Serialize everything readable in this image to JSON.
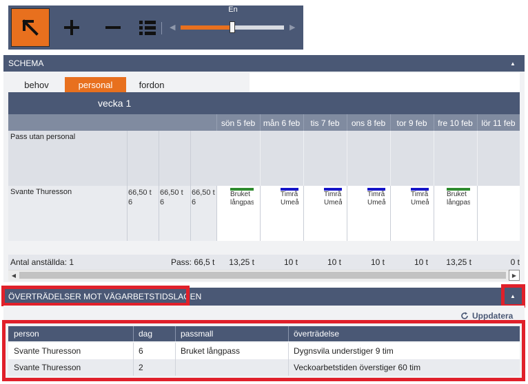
{
  "toolbar": {
    "zoom_label": "En",
    "zoom_level": 0.5,
    "icons": [
      "select-arrow-icon",
      "plus-icon",
      "minus-icon",
      "list-icon"
    ]
  },
  "schema": {
    "title": "SCHEMA",
    "tabs": [
      "behov",
      "personal",
      "fordon"
    ],
    "active_tab": "personal",
    "week": "vecka 1",
    "days": [
      "sön 5 feb",
      "mån 6 feb",
      "tis 7 feb",
      "ons 8 feb",
      "tor 9 feb",
      "fre 10 feb",
      "lör 11 feb"
    ],
    "rows": [
      {
        "name": "Pass utan personal"
      },
      {
        "name": "Svante Thuresson",
        "values": [
          "66,50 t 6",
          "66,50 t 6",
          "66,50 t 6"
        ],
        "shifts": [
          {
            "text": "Bruket långpass",
            "color": "#2e8b2e"
          },
          {
            "text": "Timrå Umeå",
            "color": "#1515c8"
          },
          {
            "text": "Timrå Umeå",
            "color": "#1515c8"
          },
          {
            "text": "Timrå Umeå",
            "color": "#1515c8"
          },
          {
            "text": "Timrå Umeå",
            "color": "#1515c8"
          },
          {
            "text": "Bruket långpass",
            "color": "#2e8b2e"
          }
        ]
      }
    ],
    "totals": {
      "employees": "Antal anställda: 1",
      "pass": "Pass: 66,5 t",
      "per_day": [
        "13,25 t",
        "10 t",
        "10 t",
        "10 t",
        "10 t",
        "13,25 t",
        "0 t"
      ]
    }
  },
  "violations": {
    "title": "ÖVERTRÄDELSER MOT VÄGARBETSTIDSLAGEN",
    "refresh_label": "Uppdatera",
    "columns": [
      "person",
      "dag",
      "passmall",
      "överträdelse"
    ],
    "rows": [
      [
        "Svante Thuresson",
        "6",
        "Bruket långpass",
        "Dygnsvila understiger 9 tim"
      ],
      [
        "Svante Thuresson",
        "2",
        "",
        "Veckoarbetstiden överstiger 60 tim"
      ]
    ]
  },
  "colors": {
    "header": "#4a5875",
    "accent": "#e8701e",
    "highlight": "#e0202a"
  }
}
